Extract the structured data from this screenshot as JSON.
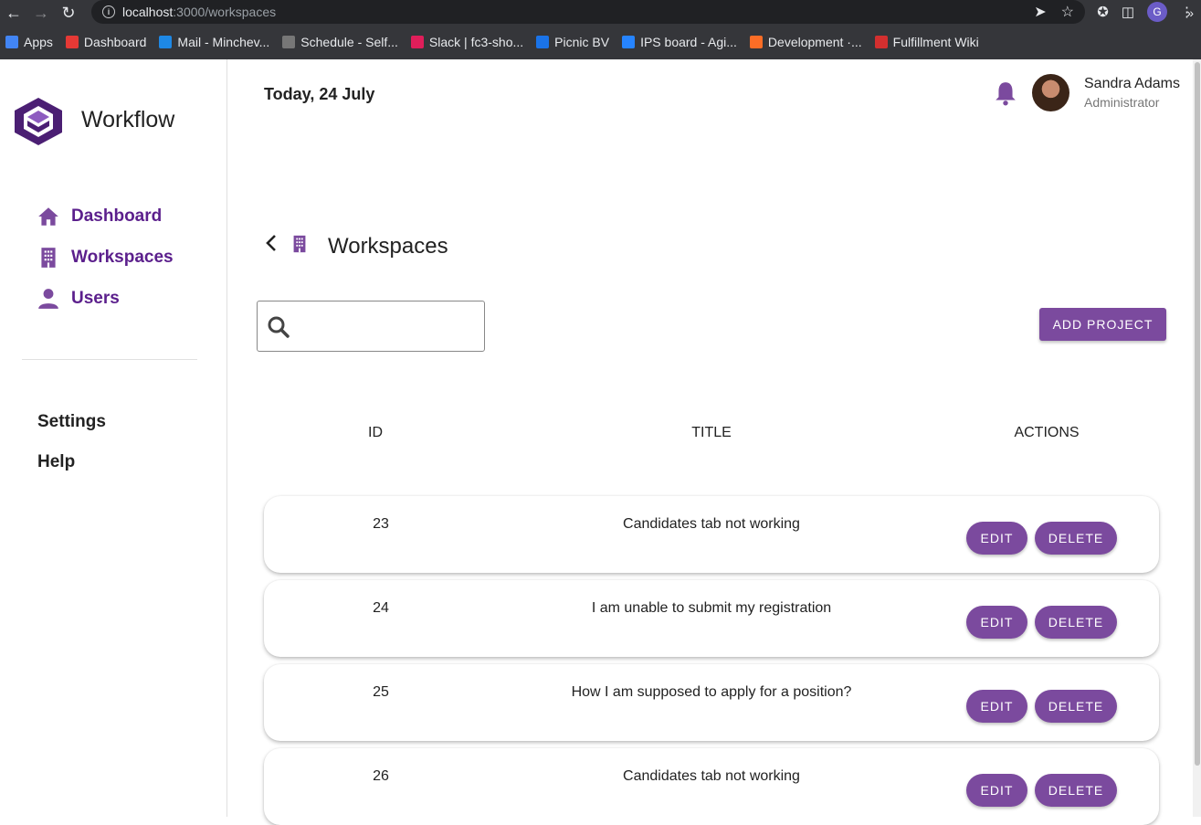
{
  "browser": {
    "url_host": "localhost",
    "url_path": ":3000/workspaces",
    "profile_initial": "G",
    "bookmarks": [
      {
        "label": "Apps",
        "color": "#4285f4"
      },
      {
        "label": "Dashboard",
        "color": "#e53935"
      },
      {
        "label": "Mail - Minchev...",
        "color": "#1e88e5"
      },
      {
        "label": "Schedule - Self...",
        "color": "#777777"
      },
      {
        "label": "Slack | fc3-sho...",
        "color": "#e01e5a"
      },
      {
        "label": "Picnic BV",
        "color": "#1a73e8"
      },
      {
        "label": "IPS board - Agi...",
        "color": "#2684ff"
      },
      {
        "label": "Development ·...",
        "color": "#fc6d26"
      },
      {
        "label": "Fulfillment Wiki",
        "color": "#d32f2f"
      }
    ],
    "more": "»"
  },
  "sidebar": {
    "brand": "Workflow",
    "nav": [
      {
        "label": "Dashboard",
        "icon": "home-icon"
      },
      {
        "label": "Workspaces",
        "icon": "building-icon"
      },
      {
        "label": "Users",
        "icon": "person-icon"
      }
    ],
    "links": [
      "Settings",
      "Help"
    ]
  },
  "header": {
    "date": "Today, 24 July",
    "user_name": "Sandra Adams",
    "user_role": "Administrator"
  },
  "page": {
    "title": "Workspaces",
    "search_placeholder": "",
    "add_label": "ADD PROJECT"
  },
  "table": {
    "columns": [
      "ID",
      "TITLE",
      "ACTIONS"
    ],
    "rows": [
      {
        "id": "23",
        "title": "Candidates tab not working"
      },
      {
        "id": "24",
        "title": "I am unable to submit my registration"
      },
      {
        "id": "25",
        "title": "How I am supposed to apply for a position?"
      },
      {
        "id": "26",
        "title": "Candidates tab not working"
      }
    ],
    "edit_label": "EDIT",
    "delete_label": "DELETE"
  },
  "colors": {
    "accent": "#7b4a9e",
    "nav_text": "#5b1f8c"
  }
}
